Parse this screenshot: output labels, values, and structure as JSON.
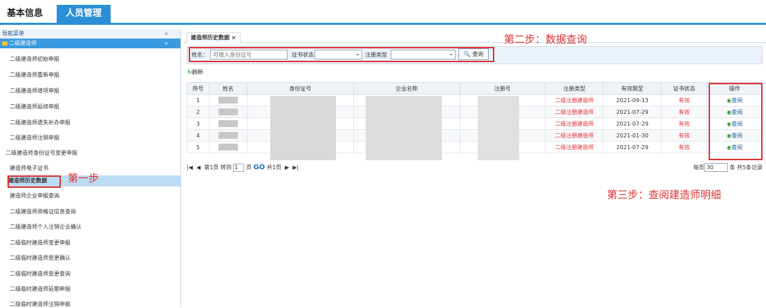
{
  "topnav": {
    "tab_basic": "基本信息",
    "tab_people": "人员管理"
  },
  "sidebar": {
    "header": "导航菜单",
    "collapse": "«",
    "group": "二级建造师",
    "group_caret": "«",
    "items": [
      "二级建造师初始申报",
      "二级建造师重新申报",
      "二级建造师增项申报",
      "二级建造师延续申报",
      "二级建造师遗失补办申报",
      "二级建造师注销申报",
      "二级建造师身份证号变更申报",
      "建造师电子证书",
      "建造师历史数据",
      "建造师企业申报查询",
      "二级建造师资格证信息查询",
      "二级建造师个人注销企业确认",
      "二级临时建造师变更申报",
      "二级临时建造师变更确认",
      "二级临时建造师变更查询",
      "二级临时建造师延期申报",
      "二级临时建造师注销申报"
    ]
  },
  "annotations": {
    "step1": "第一步",
    "step2": "第二步：数据查询",
    "step3": "第三步：查阅建造师明细"
  },
  "main": {
    "tab": "建造师历史数据 ×",
    "search": {
      "name_label": "姓名：",
      "name_placeholder": "可填入身份证号",
      "cert_label": "证书状态",
      "reg_label": "注册类型",
      "query_btn": "🔍 查询"
    },
    "refresh": "刷新",
    "columns": [
      "序号",
      "姓名",
      "身份证号",
      "企业名称",
      "注册号",
      "注册类型",
      "有效期至",
      "证书状态",
      "操作"
    ],
    "rows": [
      {
        "seq": "1",
        "reg_type": "二级注册建造师",
        "valid": "2021-09-13",
        "status": "有效",
        "op": "查阅"
      },
      {
        "seq": "2",
        "reg_type": "二级注册建造师",
        "valid": "2021-07-29",
        "status": "有效",
        "op": "查阅"
      },
      {
        "seq": "3",
        "reg_type": "二级注册建造师",
        "valid": "2021-07-29",
        "status": "有效",
        "op": "查阅"
      },
      {
        "seq": "4",
        "reg_type": "二级注册建造师",
        "valid": "2021-01-30",
        "status": "有效",
        "op": "查阅"
      },
      {
        "seq": "5",
        "reg_type": "二级注册建造师",
        "valid": "2021-07-29",
        "status": "有效",
        "op": "查阅"
      }
    ],
    "pager": {
      "first": "|◀",
      "prev": "◀",
      "page_text": "第1页 转到",
      "page_input": "1",
      "page_unit": "页",
      "go": "GO",
      "total_pages": "共1页",
      "next": "▶",
      "last": "▶|",
      "per_page_label": "每页",
      "per_page_value": "30",
      "per_page_suffix": "条 共5条记录"
    }
  },
  "colors": {
    "accent": "#2a8fd6",
    "highlight": "#e03030"
  }
}
